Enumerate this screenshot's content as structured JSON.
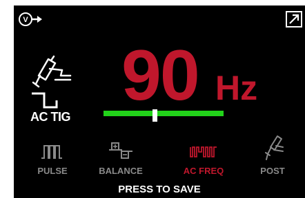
{
  "icons": {
    "top_left": "volt-output-icon",
    "top_right": "expand-arrow-icon",
    "mode": "tig-torch-ac-wave-icon"
  },
  "mode": {
    "label": "AC TIG"
  },
  "setting": {
    "value": "90",
    "unit": "Hz"
  },
  "slider": {
    "position": 0.43,
    "track_color": "#22d31a",
    "thumb_color": "#ffffff"
  },
  "menu": [
    {
      "label": "PULSE",
      "icon": "pulse-wave-icon",
      "active": false
    },
    {
      "label": "BALANCE",
      "icon": "balance-icon",
      "active": false
    },
    {
      "label": "AC FREQ",
      "icon": "ac-frequency-icon",
      "active": true
    },
    {
      "label": "POST",
      "icon": "post-flow-torch-icon",
      "active": false
    }
  ],
  "footer": {
    "text": "PRESS TO SAVE"
  },
  "colors": {
    "accent": "#c0172c",
    "inactive": "#8a8a8a",
    "background": "#000000"
  }
}
